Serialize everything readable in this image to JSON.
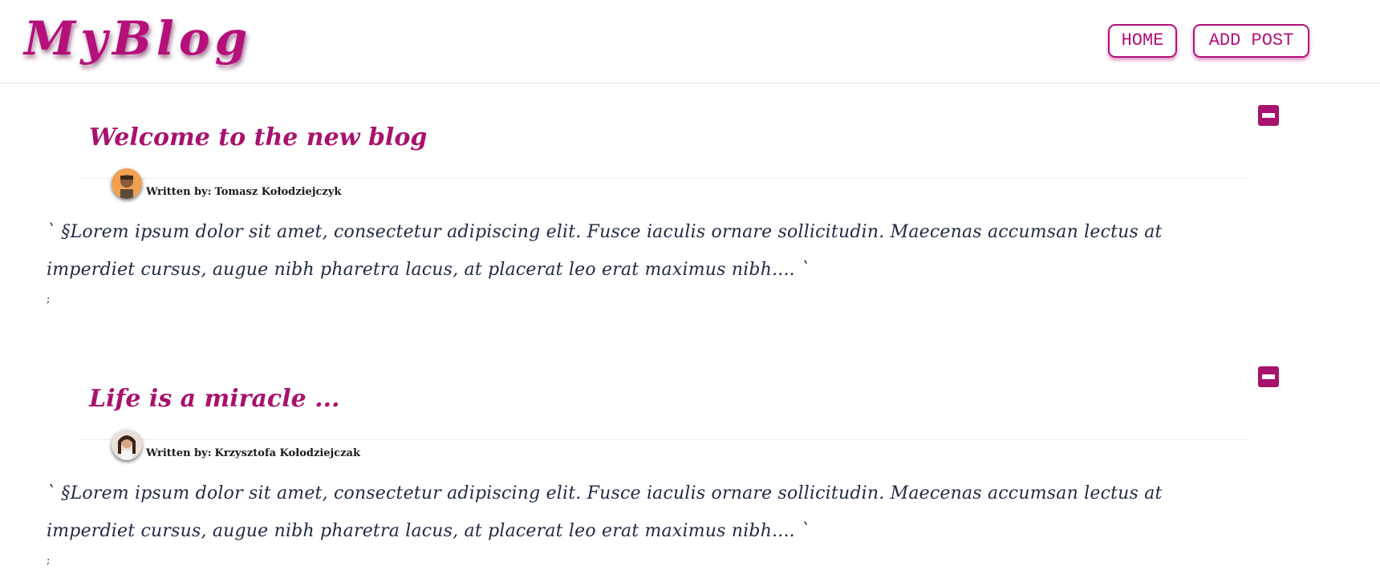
{
  "header": {
    "logo": "MyBlog",
    "nav": {
      "home_label": "HOME",
      "add_post_label": "ADD POST"
    }
  },
  "posts": [
    {
      "title": "Welcome to the new blog",
      "author_prefix": "Written by:",
      "author": "Tomasz Kołodziejczyk",
      "body": "` §Lorem ipsum dolor sit amet, consectetur adipiscing elit. Fusce iaculis ornare sollicitudin. Maecenas accumsan lectus at imperdiet cursus, augue nibh pharetra lacus, at placerat leo erat maximus nibh.... `",
      "trailing": ";"
    },
    {
      "title": "Life is a miracle ...",
      "author_prefix": "Written by:",
      "author": "Krzysztofa Kołodziejczak",
      "body": "` §Lorem ipsum dolor sit amet, consectetur adipiscing elit. Fusce iaculis ornare sollicitudin. Maecenas accumsan lectus at imperdiet cursus, augue nibh pharetra lacus, at placerat leo erat maximus nibh.... `",
      "trailing": ";"
    }
  ],
  "icons": {
    "collapse": "minus-square-icon",
    "avatar": "avatar"
  },
  "colors": {
    "accent": "#b5107a",
    "title": "#a8116e",
    "body_text": "#1f2a44"
  }
}
